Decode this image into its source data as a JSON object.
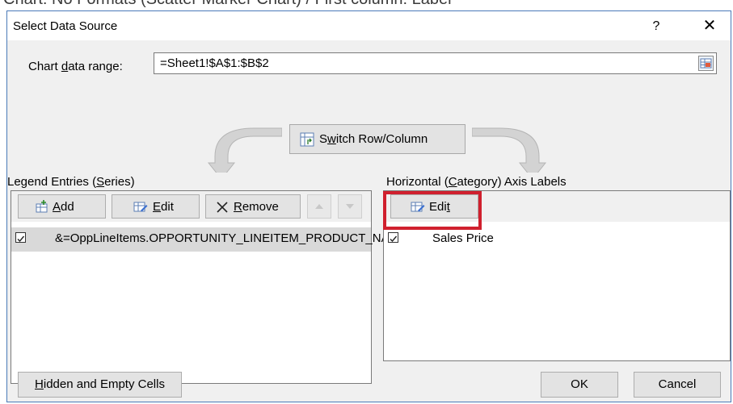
{
  "top_caption": "Chart: No Formats (Scatter Marker Chart) / First column: Label",
  "window": {
    "title": "Select Data Source",
    "help": "?",
    "close": "✕"
  },
  "data_range": {
    "label_pre": "Chart ",
    "label_acc": "d",
    "label_post": "ata range:",
    "value": "=Sheet1!$A$1:$B$2"
  },
  "switch": {
    "label_pre": "S",
    "label_acc": "w",
    "label_post": "itch Row/Column"
  },
  "legend": {
    "label_pre": "Legend Entries (",
    "label_acc": "S",
    "label_post": "eries)",
    "add_acc": "A",
    "add_post": "dd",
    "edit_acc": "E",
    "edit_post": "dit",
    "remove_acc": "R",
    "remove_post": "emove",
    "items": [
      {
        "text": "&=OppLineItems.OPPORTUNITY_LINEITEM_PRODUCT_NAME",
        "checked": true
      }
    ]
  },
  "axis": {
    "label_pre": "Horizontal (",
    "label_acc": "C",
    "label_post": "ategory) Axis Labels",
    "edit_pre": "Edi",
    "edit_acc": "t",
    "items": [
      {
        "text": "Sales Price",
        "checked": true
      }
    ]
  },
  "hidden_cells": {
    "label_acc": "H",
    "label_post": "idden and Empty Cells"
  },
  "ok": "OK",
  "cancel": "Cancel",
  "colors": {
    "highlight": "#d0202e",
    "dialog_border": "#4a7ab8"
  }
}
